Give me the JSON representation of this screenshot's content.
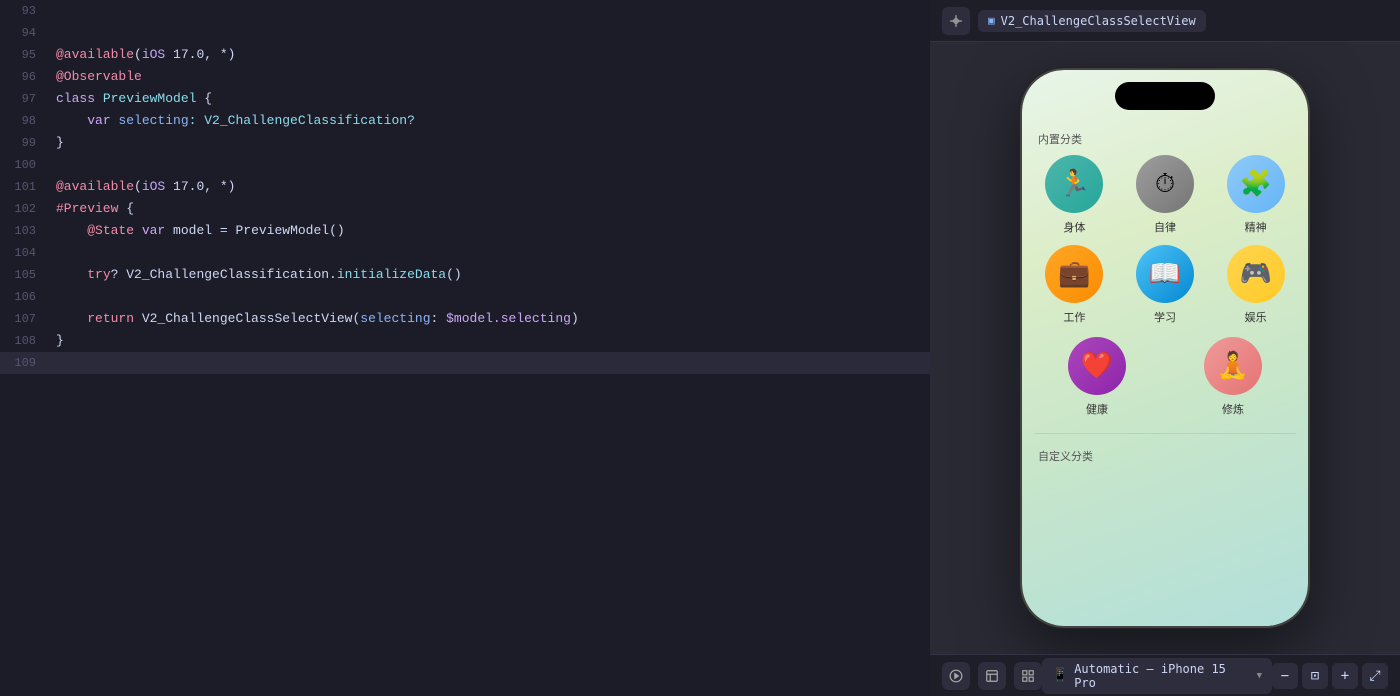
{
  "editor": {
    "lines": [
      {
        "num": 93,
        "tokens": [],
        "active": false
      },
      {
        "num": 94,
        "tokens": [],
        "active": false
      },
      {
        "num": 95,
        "tokens": [
          {
            "text": "@available",
            "cls": "kw-available"
          },
          {
            "text": "(",
            "cls": "punct"
          },
          {
            "text": "iOS",
            "cls": "kw-ios"
          },
          {
            "text": " 17.0, *)",
            "cls": "plain"
          }
        ],
        "active": false
      },
      {
        "num": 96,
        "tokens": [
          {
            "text": "@Observable",
            "cls": "kw-observable"
          }
        ],
        "active": false
      },
      {
        "num": 97,
        "tokens": [
          {
            "text": "class",
            "cls": "kw-class"
          },
          {
            "text": " PreviewModel",
            "cls": "class-name"
          },
          {
            "text": " {",
            "cls": "plain"
          }
        ],
        "active": false
      },
      {
        "num": 98,
        "tokens": [
          {
            "text": "    ",
            "cls": "plain"
          },
          {
            "text": "var",
            "cls": "kw-var"
          },
          {
            "text": " selecting",
            "cls": "prop-name"
          },
          {
            "text": ": V2_ChallengeClassification?",
            "cls": "type-name"
          }
        ],
        "active": false
      },
      {
        "num": 99,
        "tokens": [
          {
            "text": "}",
            "cls": "plain"
          }
        ],
        "active": false
      },
      {
        "num": 100,
        "tokens": [],
        "active": false
      },
      {
        "num": 101,
        "tokens": [
          {
            "text": "@available",
            "cls": "kw-available"
          },
          {
            "text": "(",
            "cls": "punct"
          },
          {
            "text": "iOS",
            "cls": "kw-ios"
          },
          {
            "text": " 17.0, *)",
            "cls": "plain"
          }
        ],
        "active": false
      },
      {
        "num": 102,
        "tokens": [
          {
            "text": "#Preview",
            "cls": "kw-preview"
          },
          {
            "text": " {",
            "cls": "plain"
          }
        ],
        "active": false
      },
      {
        "num": 103,
        "tokens": [
          {
            "text": "    ",
            "cls": "plain"
          },
          {
            "text": "@State",
            "cls": "kw-state"
          },
          {
            "text": " var",
            "cls": "kw-var"
          },
          {
            "text": " model = PreviewModel()",
            "cls": "plain"
          }
        ],
        "active": false
      },
      {
        "num": 104,
        "tokens": [],
        "active": false
      },
      {
        "num": 105,
        "tokens": [
          {
            "text": "    ",
            "cls": "plain"
          },
          {
            "text": "try",
            "cls": "kw-try"
          },
          {
            "text": "? V2_ChallengeClassification.",
            "cls": "plain"
          },
          {
            "text": "initializeData",
            "cls": "method-call"
          },
          {
            "text": "()",
            "cls": "plain"
          }
        ],
        "active": false
      },
      {
        "num": 106,
        "tokens": [],
        "active": false
      },
      {
        "num": 107,
        "tokens": [
          {
            "text": "    ",
            "cls": "plain"
          },
          {
            "text": "return",
            "cls": "kw-return"
          },
          {
            "text": " V2_ChallengeClassSelectView(",
            "cls": "plain"
          },
          {
            "text": "selecting",
            "cls": "param-label"
          },
          {
            "text": ": ",
            "cls": "plain"
          },
          {
            "text": "$model.selecting",
            "cls": "var-ref"
          },
          {
            "text": ")",
            "cls": "plain"
          }
        ],
        "active": false
      },
      {
        "num": 108,
        "tokens": [
          {
            "text": "}",
            "cls": "plain"
          }
        ],
        "active": false
      },
      {
        "num": 109,
        "tokens": [],
        "active": true
      }
    ]
  },
  "preview": {
    "topbar": {
      "view_name": "V2_ChallengeClassSelectView"
    },
    "phone": {
      "sections": [
        {
          "label": "内置分类",
          "icons": [
            {
              "label": "身体",
              "cls": "ic-body",
              "symbol": "🏃"
            },
            {
              "label": "自律",
              "cls": "ic-self",
              "symbol": "⏱"
            },
            {
              "label": "精神",
              "cls": "ic-mental",
              "symbol": "🧩"
            },
            {
              "label": "工作",
              "cls": "ic-work",
              "symbol": "💼"
            },
            {
              "label": "学习",
              "cls": "ic-study",
              "symbol": "📖"
            },
            {
              "label": "娱乐",
              "cls": "ic-entertain",
              "symbol": "🎮"
            }
          ],
          "bottom_icons": [
            {
              "label": "健康",
              "cls": "ic-health",
              "symbol": "❤️"
            },
            {
              "label": "修炼",
              "cls": "ic-practice",
              "symbol": "🧘"
            }
          ]
        }
      ],
      "custom_section_label": "自定义分类"
    },
    "bottombar": {
      "device_label": "Automatic – iPhone 15 Pro",
      "zoom_minus": "−",
      "zoom_plus": "+",
      "zoom_fit": "⊡",
      "zoom_full": "⤢"
    }
  }
}
